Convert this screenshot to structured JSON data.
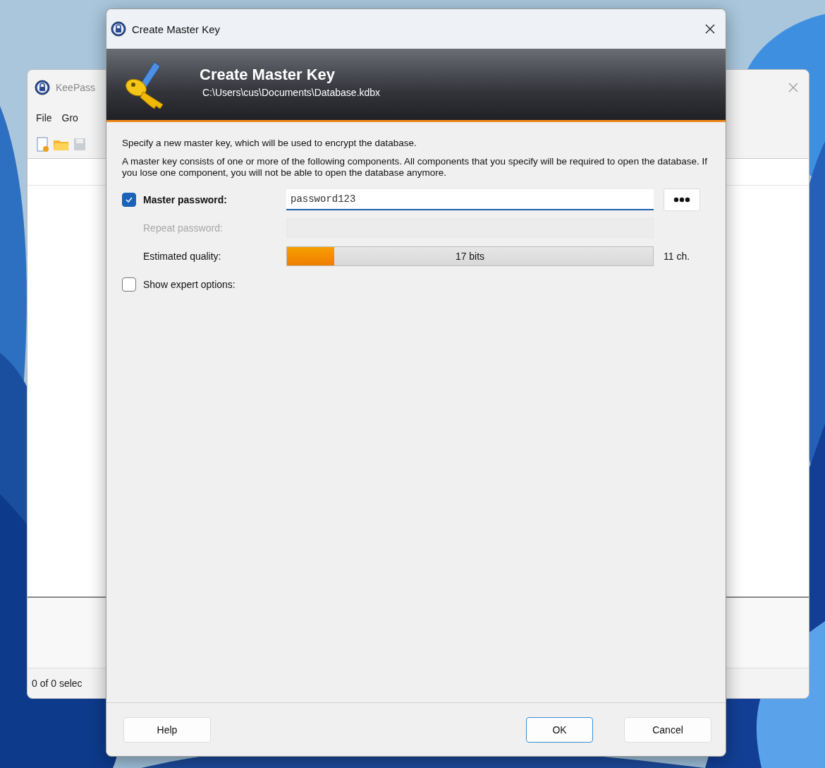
{
  "background_window": {
    "title": "KeePass",
    "menu": [
      "File",
      "Gro"
    ],
    "status_bar": "0 of 0 selec"
  },
  "dialog": {
    "title": "Create Master Key",
    "banner": {
      "title": "Create Master Key",
      "subtitle": "C:\\Users\\cus\\Documents\\Database.kdbx"
    },
    "intro": "Specify a new master key, which will be used to encrypt the database.",
    "description": "A master key consists of one or more of the following components. All components that you specify will be required to open the database. If you lose one component, you will not be able to open the database anymore.",
    "master_password": {
      "label": "Master password:",
      "checked": true,
      "value": "password123"
    },
    "repeat_password": {
      "label": "Repeat password:",
      "disabled": true
    },
    "quality": {
      "label": "Estimated quality:",
      "level": 0.13,
      "reading": "17 bits",
      "length": "11 ch."
    },
    "expert_options": {
      "label": "Show expert options:",
      "checked": false
    },
    "buttons": [
      {
        "label": "Help",
        "kind": "left",
        "default": false
      },
      {
        "label": "OK",
        "kind": "right",
        "default": true
      },
      {
        "label": "Cancel",
        "kind": "right",
        "default": false
      }
    ]
  }
}
